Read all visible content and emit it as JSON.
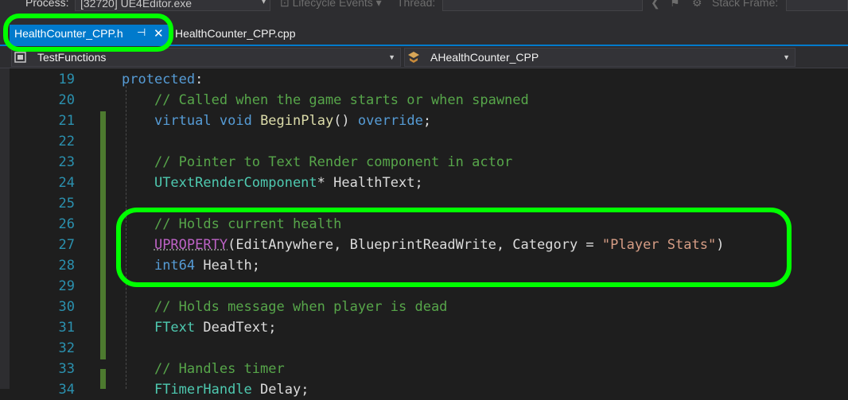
{
  "toolbar": {
    "process_label": "Process:",
    "process_value": "[32720] UE4Editor.exe",
    "lifecycle_label": "Lifecycle Events",
    "thread_label": "Thread:",
    "stackframe_label": "Stack Frame:"
  },
  "tabs": [
    {
      "label": "HealthCounter_CPP.h",
      "active": true,
      "pin_icon": "pin-icon",
      "close_icon": "close-icon"
    },
    {
      "label": "HealthCounter_CPP.cpp",
      "active": false
    }
  ],
  "navbar": {
    "scope": "TestFunctions",
    "member": "AHealthCounter_CPP"
  },
  "editor": {
    "lines": [
      19,
      20,
      21,
      22,
      23,
      24,
      25,
      26,
      27,
      28,
      29,
      30,
      31,
      32,
      33,
      34
    ],
    "code": {
      "l19_kw": "protected",
      "l19_p": ":",
      "l20": "// Called when the game starts or when spawned",
      "l21_kw1": "virtual",
      "l21_kw2": "void",
      "l21_fn": "BeginPlay",
      "l21_p": "()",
      "l21_kw3": "override",
      "l21_end": ";",
      "l23": "// Pointer to Text Render component in actor",
      "l24_ty": "UTextRenderComponent",
      "l24_rest": "* HealthText;",
      "l26": "// Holds current health",
      "l27_mc": "UPROPERTY",
      "l27_args": "(EditAnywhere, BlueprintReadWrite, Category = ",
      "l27_str": "\"Player Stats\"",
      "l27_end": ")",
      "l28_kw": "int64",
      "l28_rest": " Health;",
      "l30": "// Holds message when player is dead",
      "l31_ty": "FText",
      "l31_rest": " DeadText;",
      "l33": "// Handles timer",
      "l34_ty": "FTimerHandle",
      "l34_rest": " Delay;"
    }
  },
  "colors": {
    "accent": "#007acc",
    "highlight": "#00ff00",
    "comment": "#57a64a",
    "keyword": "#569cd6"
  }
}
